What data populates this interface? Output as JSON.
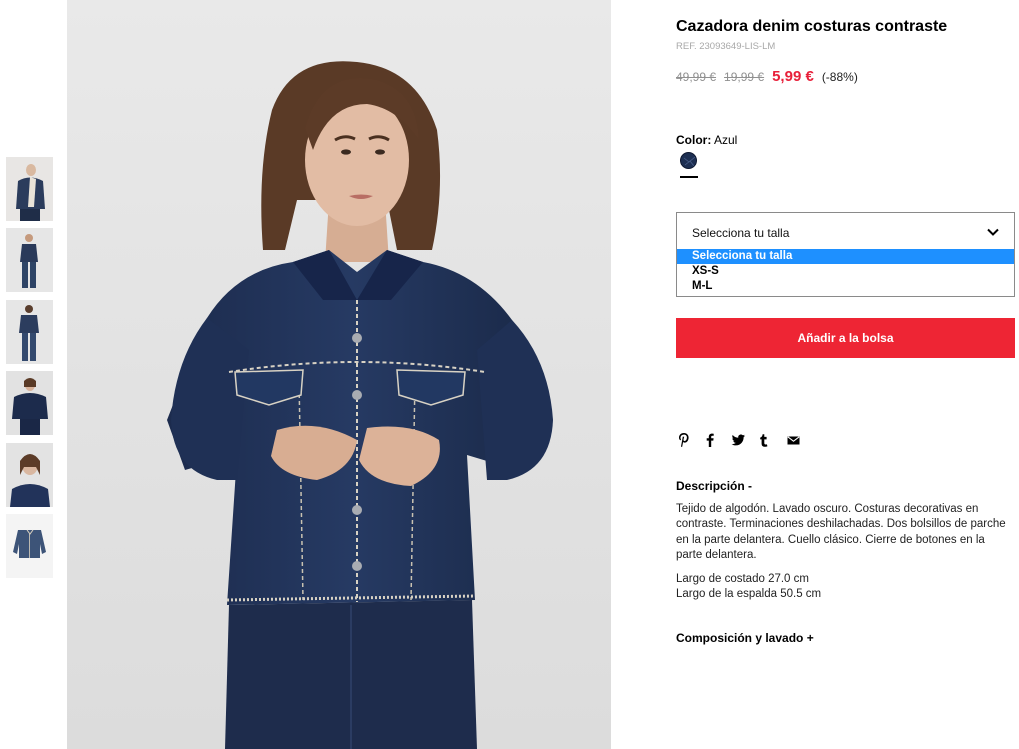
{
  "product": {
    "title": "Cazadora denim costuras contraste",
    "ref": "REF. 23093649-LIS-LM",
    "price_original": "49,99 €",
    "price_previous": "19,99 €",
    "price_current": "5,99 €",
    "discount": "(-88%)"
  },
  "color": {
    "label": "Color:",
    "value": "Azul",
    "swatch_hex": "#1d2f52"
  },
  "size_select": {
    "selected": "Selecciona tu talla",
    "options": [
      "Selecciona tu talla",
      "XS-S",
      "M-L"
    ]
  },
  "add_to_bag": "Añadir a la bolsa",
  "share_icons": [
    "pinterest-icon",
    "facebook-icon",
    "twitter-icon",
    "tumblr-icon",
    "email-icon"
  ],
  "description": {
    "heading": "Descripción -",
    "text": "Tejido de algodón. Lavado oscuro. Costuras decorativas en contraste. Terminaciones deshilachadas. Dos bolsillos de parche en la parte delantera. Cuello clásico. Cierre de botones en la parte delantera.",
    "length_side": "Largo de costado 27.0 cm",
    "length_back": "Largo de la espalda 50.5 cm"
  },
  "composition_heading": "Composición y lavado +",
  "colors": {
    "accent_red": "#ee2534",
    "price_red": "#e8203a",
    "denim": "#1d2f52",
    "option_highlight": "#1e90ff"
  }
}
